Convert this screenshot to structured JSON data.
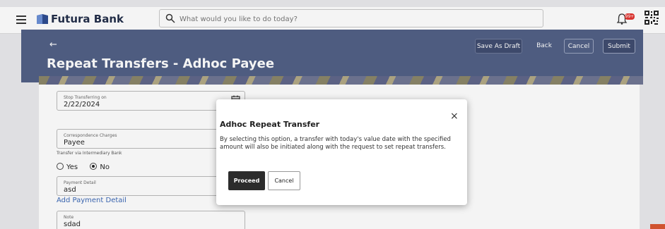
{
  "topbar": {
    "brand": "Futura Bank",
    "search_placeholder": "What would you like to do today?",
    "notification_badge": "99+"
  },
  "header": {
    "title": "Repeat Transfers - Adhoc Payee",
    "buttons": {
      "save_draft": "Save As Draft",
      "back": "Back",
      "cancel": "Cancel",
      "submit": "Submit"
    }
  },
  "form": {
    "stop_transferring": {
      "label": "Stop Transferring on",
      "value": "2/22/2024"
    },
    "correspondence": {
      "label": "Correspondence Charges",
      "value": "Payee"
    },
    "intermediary_label": "Transfer via Intermediary Bank",
    "radio_yes": "Yes",
    "radio_no": "No",
    "payment_detail": {
      "label": "Payment Detail",
      "value": "asd"
    },
    "add_payment_link": "Add Payment Detail",
    "note": {
      "label": "Note",
      "value": "sdad"
    }
  },
  "modal": {
    "title": "Adhoc Repeat Transfer",
    "body": "By selecting this option, a transfer with today's value date with the specified amount will also be initiated along with the request to set repeat transfers.",
    "proceed": "Proceed",
    "cancel": "Cancel",
    "close_glyph": "×"
  },
  "icons": [
    "hamburger-icon",
    "bank-logo-icon",
    "search-icon",
    "bell-icon",
    "qr-code-icon",
    "calendar-icon",
    "back-arrow-icon",
    "close-icon"
  ]
}
